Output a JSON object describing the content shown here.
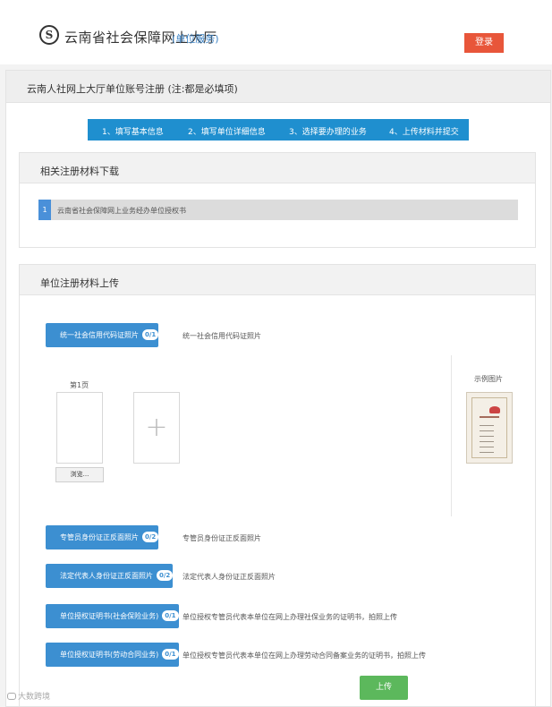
{
  "header": {
    "logo_letter": "S",
    "title": "云南省社会保障网上大厅",
    "subtitle": "(单位服务)",
    "login_label": "登录"
  },
  "panel": {
    "title": "云南人社网上大厅单位账号注册 (注:都是必填项)"
  },
  "steps": [
    {
      "label": "1、填写基本信息"
    },
    {
      "label": "2、填写单位详细信息"
    },
    {
      "label": "3、选择要办理的业务"
    },
    {
      "label": "4、上传材料并提交"
    }
  ],
  "download_section": {
    "title": "相关注册材料下载",
    "items": [
      {
        "index": "1",
        "text": "云南省社会保障网上业务经办单位授权书"
      }
    ]
  },
  "upload_section": {
    "title": "单位注册材料上传",
    "items": [
      {
        "button_label": "统一社会信用代码证照片",
        "count": "0/1",
        "description": "统一社会信用代码证照片"
      },
      {
        "button_label": "专管员身份证正反面照片",
        "count": "0/2",
        "description": "专管员身份证正反面照片"
      },
      {
        "button_label": "法定代表人身份证正反面照片",
        "count": "0/2",
        "description": "法定代表人身份证正反面照片"
      },
      {
        "button_label": "单位授权证明书(社会保险业务)",
        "count": "0/1",
        "description": "单位授权专管员代表本单位在网上办理社保业务的证明书，拍照上传"
      },
      {
        "button_label": "单位授权证明书(劳动合同业务)",
        "count": "0/1",
        "description": "单位授权专管员代表本单位在网上办理劳动合同备案业务的证明书，拍照上传"
      }
    ],
    "page_label": "第1页",
    "browse_label": "浏览...",
    "example_label": "示例图片",
    "submit_label": "上传"
  },
  "watermark": "大数跨境"
}
